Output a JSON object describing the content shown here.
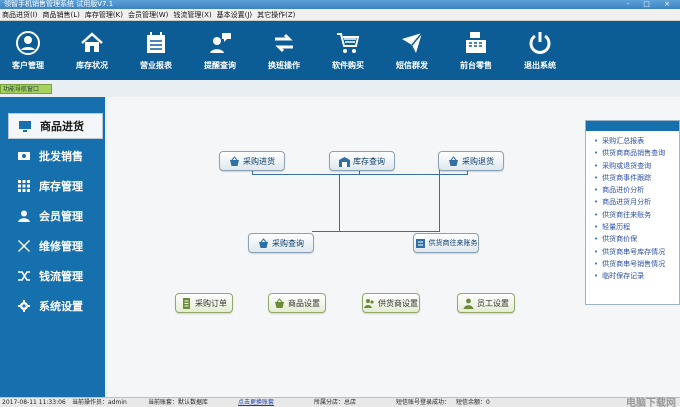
{
  "window": {
    "title": "领智手机销售管理系统 试用版V7.1",
    "controls": "- □ ×"
  },
  "menu": [
    "商品进货(I)",
    "商品销售(L)",
    "库存管理(K)",
    "会员管理(W)",
    "钱流管理(X)",
    "基本设置(J)",
    "其它操作(Z)"
  ],
  "toolbar": [
    {
      "label": "客户管理",
      "icon": "user-icon"
    },
    {
      "label": "库存状况",
      "icon": "home-icon"
    },
    {
      "label": "营业报表",
      "icon": "report-icon"
    },
    {
      "label": "提醒查询",
      "icon": "chat-user-icon"
    },
    {
      "label": "换班操作",
      "icon": "swap-icon"
    },
    {
      "label": "软件购买",
      "icon": "cart-icon"
    },
    {
      "label": "短信群发",
      "icon": "envelope-icon"
    },
    {
      "label": "前台零售",
      "icon": "cash-register-icon"
    },
    {
      "label": "退出系统",
      "icon": "power-icon"
    }
  ],
  "nav_tag": "功能导航窗口",
  "sidebar": [
    {
      "label": "商品进货",
      "icon": "monitor-icon",
      "active": true
    },
    {
      "label": "批发销售",
      "icon": "cash-icon"
    },
    {
      "label": "库存管理",
      "icon": "grid-icon"
    },
    {
      "label": "会员管理",
      "icon": "person-icon"
    },
    {
      "label": "维修管理",
      "icon": "tools-icon"
    },
    {
      "label": "钱流管理",
      "icon": "shuffle-icon"
    },
    {
      "label": "系统设置",
      "icon": "gear-icon"
    }
  ],
  "flow": {
    "purchase_in": "采购进货",
    "stock_query": "库存查询",
    "purchase_return": "采购退货",
    "purchase_query": "采购查询",
    "supplier_account": "供货商往来账务",
    "purchase_order": "采购订单",
    "product_settings": "商品设置",
    "supplier_settings": "供货商设置",
    "staff_settings": "员工设置"
  },
  "reports": [
    "采购汇总报表",
    "供货商商品销售查询",
    "采购或退货查询",
    "供货商事件跟踪",
    "商品进价分析",
    "商品进货月分析",
    "供货商往来账务",
    "轻量历程",
    "供货商价保",
    "供货商串号库存情况",
    "供货商串号销售情况",
    "临时保存记录"
  ],
  "status": {
    "datetime": "2017-08-11 11:33:06",
    "operator": "当前操作员：admin",
    "account": "当前账套：默认数据库",
    "switch_account": "点击更换账套",
    "branch": "所属分店：总店",
    "sms_ok": "短信账号登录成功：",
    "sms_balance": "短信余额：0"
  },
  "watermark": "电脑下载网",
  "colors": {
    "toolbar": "#0c5d96",
    "sidebar": "#1670ad",
    "nav_tag": "#a8d25e"
  }
}
